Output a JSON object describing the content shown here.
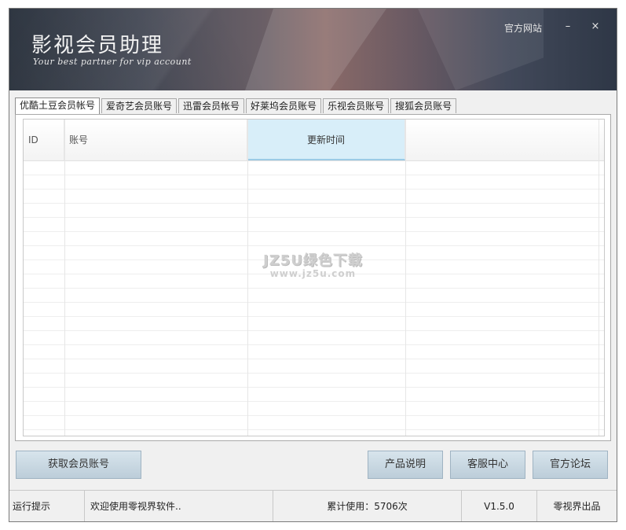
{
  "window": {
    "title": "影视会员助理",
    "subtitle": "Your best partner for vip account",
    "official_site": "官方网站",
    "minimize": "–",
    "close": "×"
  },
  "tabs": [
    {
      "label": "优酷土豆会员帐号",
      "active": true
    },
    {
      "label": "爱奇艺会员账号",
      "active": false
    },
    {
      "label": "迅雷会员帐号",
      "active": false
    },
    {
      "label": "好莱坞会员账号",
      "active": false
    },
    {
      "label": "乐视会员账号",
      "active": false
    },
    {
      "label": "搜狐会员账号",
      "active": false
    }
  ],
  "table": {
    "columns": [
      "ID",
      "账号",
      "更新时间",
      ""
    ]
  },
  "watermark": {
    "line1": "JZ5U绿色下载",
    "line2": "www.jz5u.com"
  },
  "buttons": {
    "get_account": "获取会员账号",
    "product_info": "产品说明",
    "support": "客服中心",
    "forum": "官方论坛"
  },
  "status": {
    "label": "运行提示",
    "message": "欢迎使用零视界软件..",
    "usage": "累计使用：5706次",
    "version": "V1.5.0",
    "publisher": "零视界出品"
  }
}
